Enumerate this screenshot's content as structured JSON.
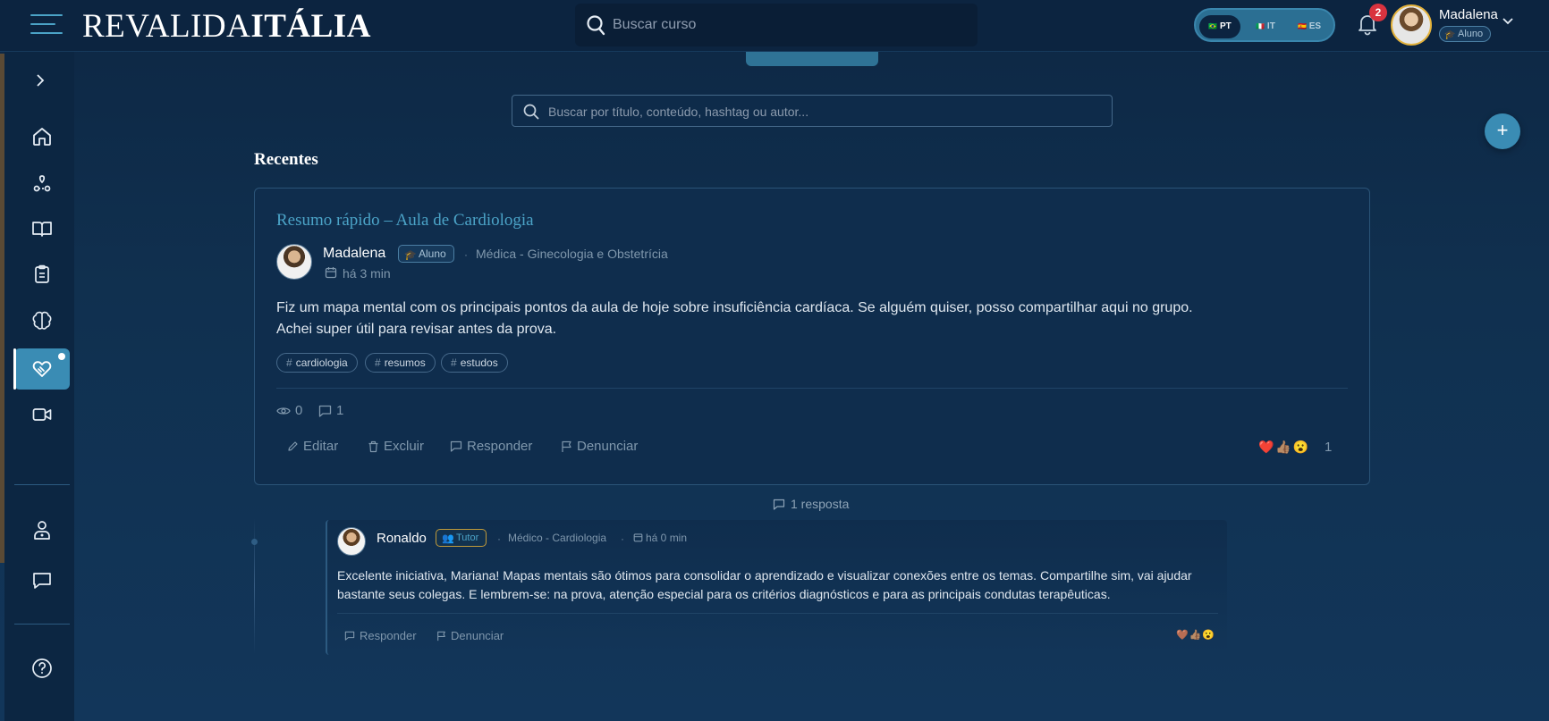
{
  "header": {
    "logo_light": "REVALIDA",
    "logo_bold": "ITÁLIA",
    "search_placeholder": "Buscar curso",
    "languages": [
      {
        "code": "PT",
        "flag": "🇧🇷"
      },
      {
        "code": "IT",
        "flag": "🇮🇹"
      },
      {
        "code": "ES",
        "flag": "🇪🇸"
      }
    ],
    "notification_count": "2",
    "user": {
      "name": "Madalena",
      "role": "Aluno"
    }
  },
  "sidebar": {
    "items": [
      {
        "icon": "home-icon"
      },
      {
        "icon": "route-icon"
      },
      {
        "icon": "book-icon"
      },
      {
        "icon": "clipboard-icon"
      },
      {
        "icon": "brain-icon"
      },
      {
        "icon": "handshake-icon",
        "active": true
      },
      {
        "icon": "video-icon"
      },
      {
        "icon": "doctor-icon"
      },
      {
        "icon": "chat-icon"
      },
      {
        "icon": "help-icon"
      }
    ]
  },
  "main": {
    "search_placeholder": "Buscar por título, conteúdo, hashtag ou autor...",
    "fab_label": "+",
    "section_title": "Recentes"
  },
  "post": {
    "title": "Resumo rápido – Aula de Cardiologia",
    "author": "Madalena",
    "role": "Aluno",
    "specialty": "Médica - Ginecologia e Obstetrícia",
    "time": "há 3 min",
    "body_line1": "Fiz um mapa mental com os principais pontos da aula de hoje sobre insuficiência cardíaca. Se alguém quiser, posso compartilhar aqui no grupo.",
    "body_line2": "Achei super útil para revisar antes da prova.",
    "tags": [
      "cardiologia",
      "resumos",
      "estudos"
    ],
    "views": "0",
    "comments": "1",
    "actions": {
      "edit": "Editar",
      "delete": "Excluir",
      "reply": "Responder",
      "report": "Denunciar"
    },
    "reactions": "❤️👍🏽😮",
    "reaction_count": "1"
  },
  "replies": {
    "count_label": "1 resposta",
    "items": [
      {
        "author": "Ronaldo",
        "role": "Tutor",
        "specialty": "Médico - Cardiologia",
        "time": "há 0 min",
        "body": "Excelente iniciativa, Mariana! Mapas mentais são ótimos para consolidar o aprendizado e visualizar conexões entre os temas. Compartilhe sim, vai ajudar bastante seus colegas. E lembrem-se: na prova, atenção especial para os critérios diagnósticos e para as principais condutas terapêuticas.",
        "actions": {
          "reply": "Responder",
          "report": "Denunciar"
        },
        "reactions": "🤎👍🏽😮"
      }
    ]
  },
  "colors": {
    "accent": "#3a8cb4",
    "title_link": "#4ba3c7",
    "background": "#0f2b4a",
    "badge_red": "#d9333f"
  }
}
